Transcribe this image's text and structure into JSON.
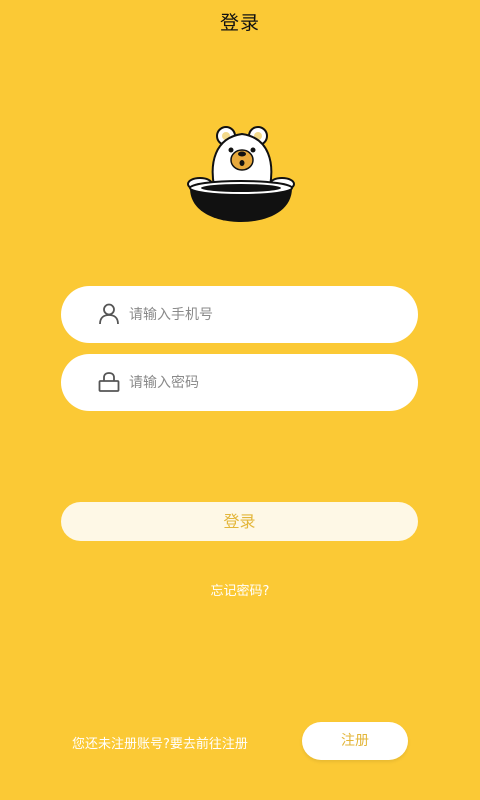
{
  "header": {
    "title": "登录"
  },
  "form": {
    "phone": {
      "placeholder": "请输入手机号",
      "icon": "user-icon"
    },
    "password": {
      "placeholder": "请输入密码",
      "icon": "lock-icon"
    },
    "login_label": "登录"
  },
  "forgot_password": "忘记密码?",
  "register": {
    "prompt": "您还未注册账号?要去前往注册",
    "button_label": "注册"
  },
  "colors": {
    "background": "#FBC935",
    "accent_text": "#E3B63A",
    "field_background": "#FFFFFF"
  }
}
